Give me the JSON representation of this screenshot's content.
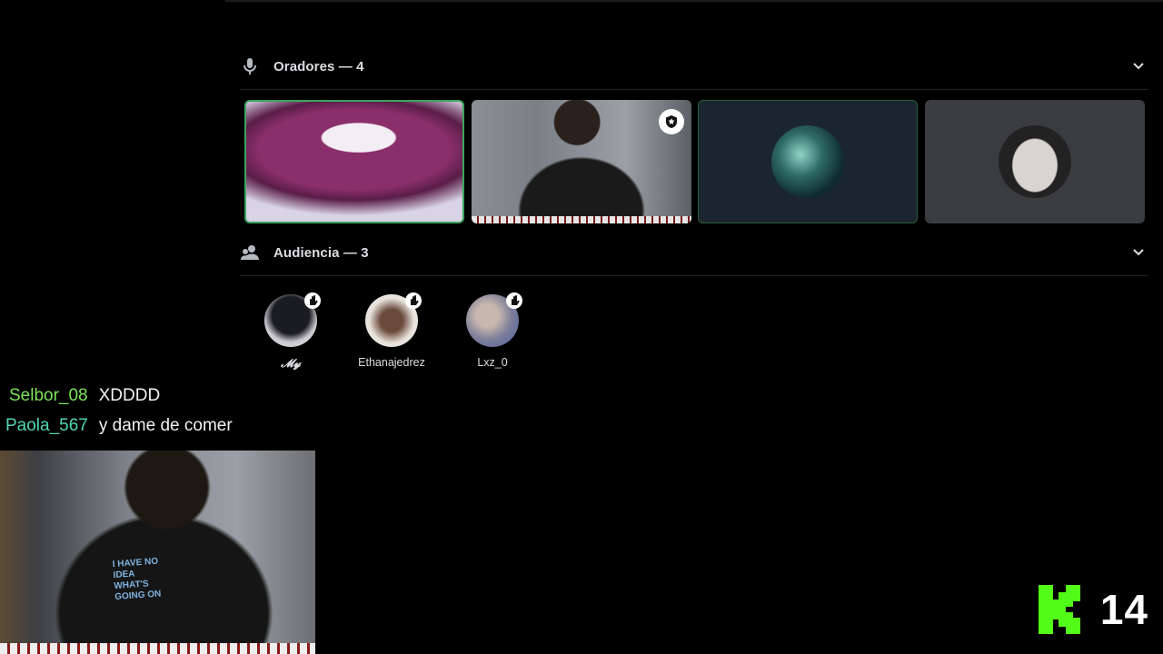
{
  "speakers": {
    "title": "Oradores — 4",
    "tiles": [
      {
        "name": "speaker-lips",
        "speaking": true
      },
      {
        "name": "speaker-cam",
        "speaking": false,
        "moderator": true
      },
      {
        "name": "speaker-avatar-teal",
        "speaking": true
      },
      {
        "name": "speaker-avatar-face",
        "speaking": false
      }
    ]
  },
  "audience": {
    "title": "Audiencia — 3",
    "members": [
      {
        "name": "𝓜𝔂"
      },
      {
        "name": "Ethanajedrez"
      },
      {
        "name": "Lxz_0"
      }
    ]
  },
  "chat": [
    {
      "user": "Selbor_08",
      "color": "#7ee35b",
      "message": "XDDDD"
    },
    {
      "user": "Paola_567",
      "color": "#4fd6b4",
      "message": "y dame de comer"
    }
  ],
  "webcam": {
    "shirt_text": "I HAVE NO IDEA WHAT'S GOING ON"
  },
  "kick": {
    "viewer_count": "14",
    "brand_color": "#53fc18"
  },
  "colors": {
    "speaking_border": "#3ba55d",
    "background": "#000000"
  }
}
